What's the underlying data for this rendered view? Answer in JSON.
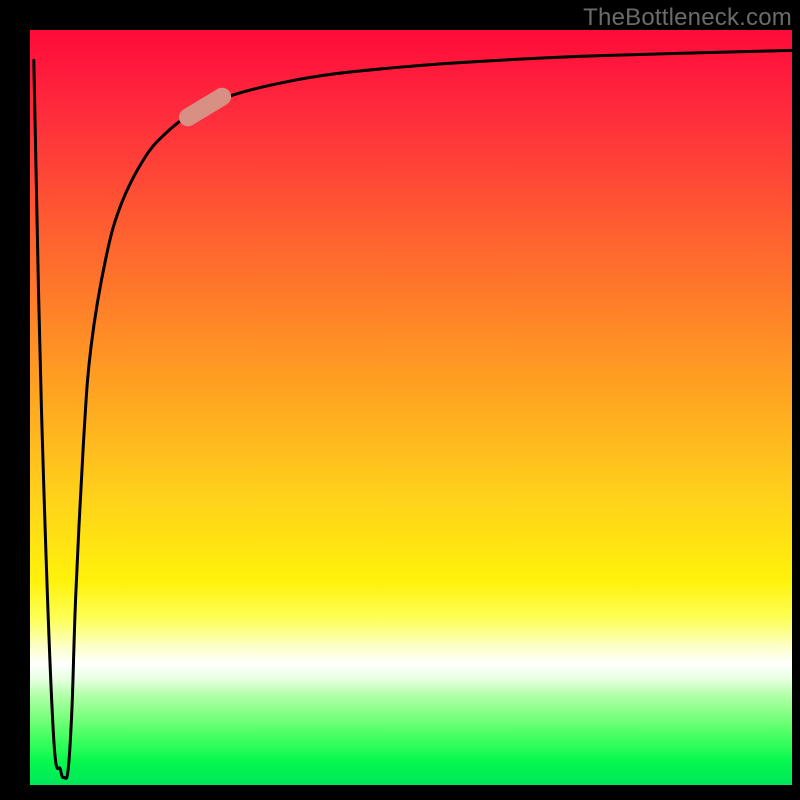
{
  "watermark": "TheBottleneck.com",
  "colors": {
    "gradient_top": "#ff0a3a",
    "gradient_mid1": "#ff6a2d",
    "gradient_mid2": "#ffd21b",
    "gradient_mid3": "#fdff58",
    "gradient_white": "#ffffff",
    "gradient_green1": "#7aff7d",
    "gradient_green2": "#00e65b",
    "curve": "#000000",
    "marker": "#d88f84",
    "frame": "#000000"
  },
  "chart_data": {
    "type": "line",
    "title": "",
    "xlabel": "",
    "ylabel": "",
    "xlim": [
      0,
      100
    ],
    "ylim": [
      0,
      100
    ],
    "grid": false,
    "legend": false,
    "annotations": [
      "TheBottleneck.com"
    ],
    "series": [
      {
        "name": "bottleneck-curve",
        "x": [
          0.5,
          1.5,
          3,
          4,
          4.5,
          5,
          5.5,
          6,
          7,
          8,
          10,
          12,
          15,
          18,
          22,
          27,
          33,
          40,
          50,
          60,
          72,
          85,
          100
        ],
        "y": [
          96,
          50,
          8,
          2,
          1,
          2,
          10,
          25,
          45,
          58,
          70,
          77,
          83,
          86.5,
          89.5,
          91.5,
          93,
          94.2,
          95.2,
          95.9,
          96.5,
          96.9,
          97.3
        ]
      }
    ],
    "marker": {
      "series": "bottleneck-curve",
      "x_center": 23,
      "y_center": 89.8,
      "angle_deg": -31
    }
  }
}
